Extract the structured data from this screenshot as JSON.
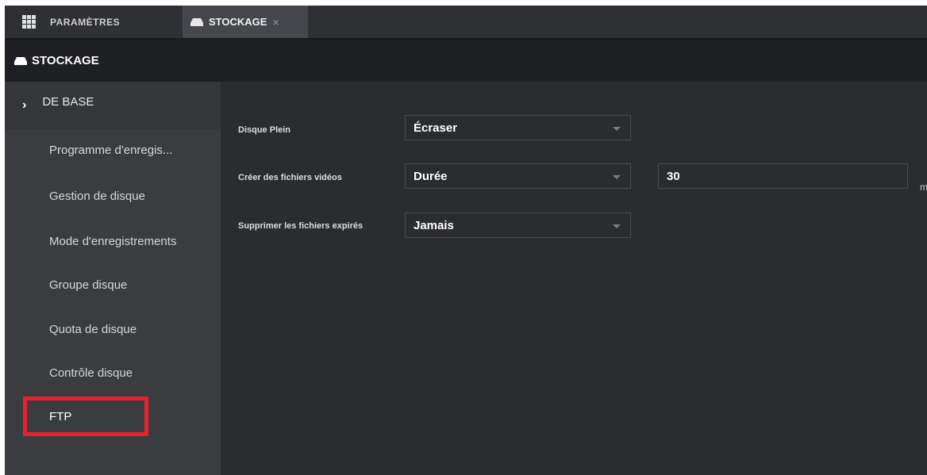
{
  "tabs": {
    "settings_label": "PARAMÈTRES",
    "storage_label": "STOCKAGE",
    "close_glyph": "×"
  },
  "title_bar": {
    "title": "STOCKAGE"
  },
  "sidebar": {
    "section_chevron": "›",
    "section_label": "DE BASE",
    "items": [
      {
        "label": "Programme d'enregis..."
      },
      {
        "label": "Gestion de disque"
      },
      {
        "label": "Mode d'enregistrements"
      },
      {
        "label": "Groupe disque"
      },
      {
        "label": "Quota de disque"
      },
      {
        "label": "Contrôle disque"
      },
      {
        "label": "FTP"
      }
    ]
  },
  "form": {
    "disk_full": {
      "label": "Disque Plein",
      "value": "Écraser"
    },
    "create_video_files": {
      "label": "Créer des fichiers vidéos",
      "value": "Durée",
      "duration_value": "30",
      "unit": "min."
    },
    "delete_expired": {
      "label": "Supprimer les fichiers expirés",
      "value": "Jamais"
    }
  },
  "icons": {
    "settings_tab": "grid-icon",
    "storage_tab": "hard-drive-icon",
    "title": "hard-drive-icon",
    "section": "chevron-right-icon",
    "dropdown": "caret-down-icon"
  },
  "colors": {
    "highlight_box": "#e8202a",
    "background": "#2b2c30",
    "sidebar": "#3a3c40",
    "title_bar": "#1e1f22"
  }
}
